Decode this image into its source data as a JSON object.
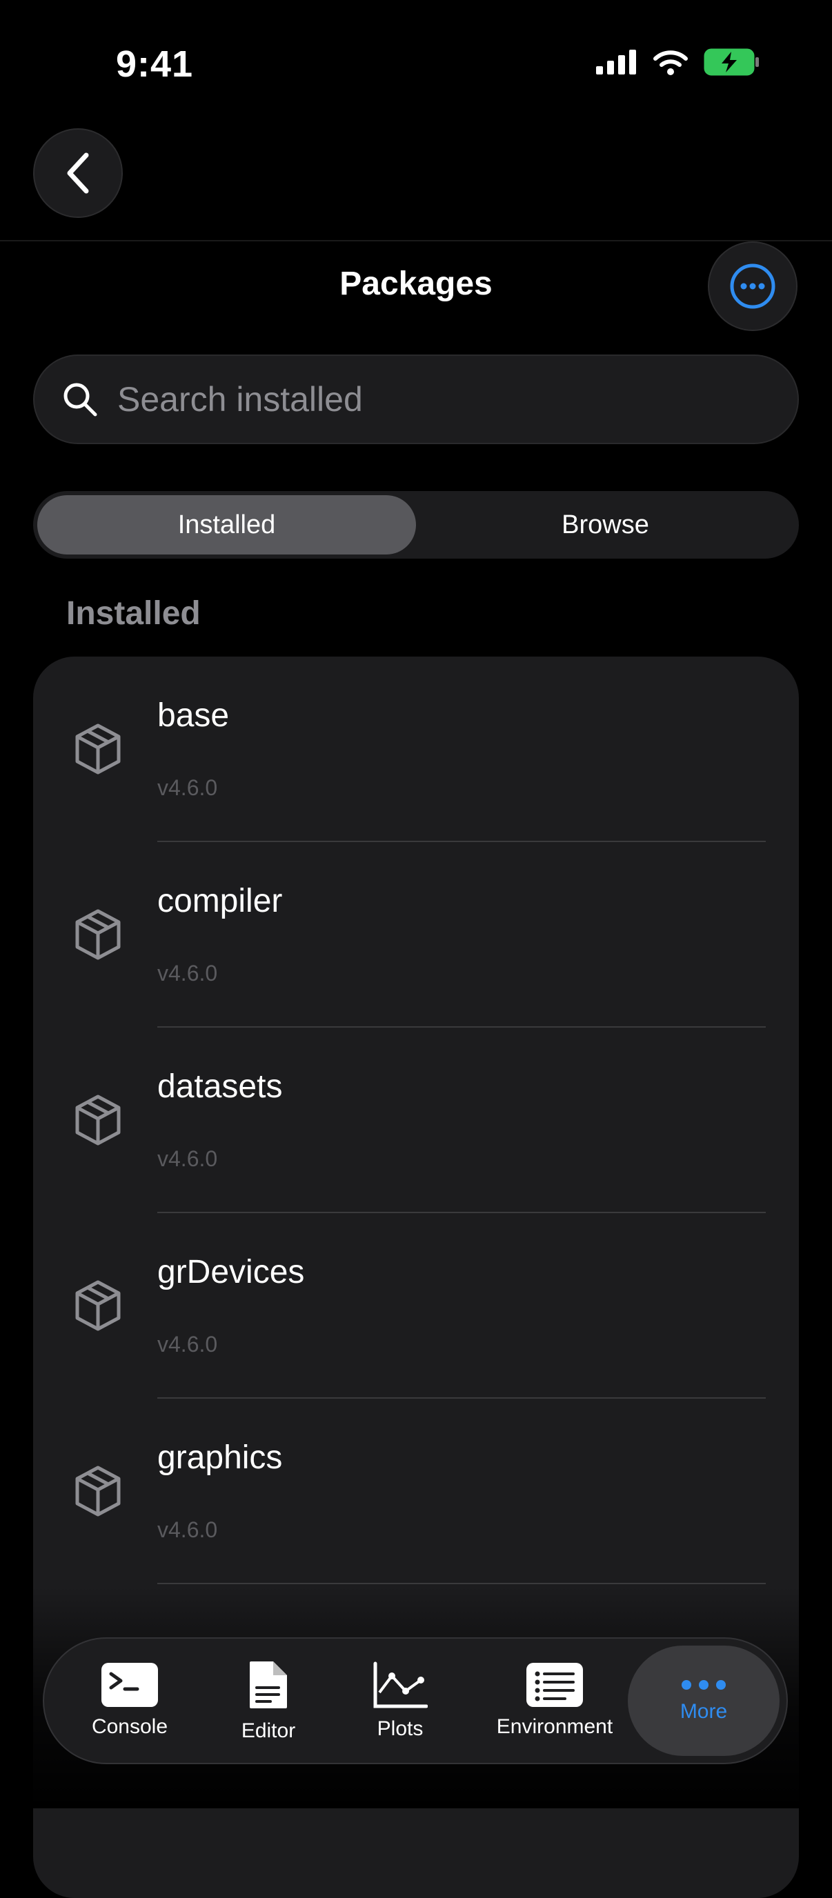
{
  "status": {
    "time": "9:41"
  },
  "header": {
    "title": "Packages"
  },
  "search": {
    "placeholder": "Search installed"
  },
  "segments": {
    "installed": "Installed",
    "browse": "Browse",
    "selected": "Installed"
  },
  "section": {
    "label": "Installed"
  },
  "packages": [
    {
      "name": "base",
      "version": "v4.6.0"
    },
    {
      "name": "compiler",
      "version": "v4.6.0"
    },
    {
      "name": "datasets",
      "version": "v4.6.0"
    },
    {
      "name": "grDevices",
      "version": "v4.6.0"
    },
    {
      "name": "graphics",
      "version": "v4.6.0"
    }
  ],
  "tabs": [
    {
      "label": "Console",
      "icon": "terminal-icon"
    },
    {
      "label": "Editor",
      "icon": "document-icon"
    },
    {
      "label": "Plots",
      "icon": "line-chart-icon"
    },
    {
      "label": "Environment",
      "icon": "list-icon"
    },
    {
      "label": "More",
      "icon": "ellipsis-icon",
      "active": true
    }
  ],
  "colors": {
    "accent": "#2f8cf0",
    "battery": "#34c759"
  }
}
